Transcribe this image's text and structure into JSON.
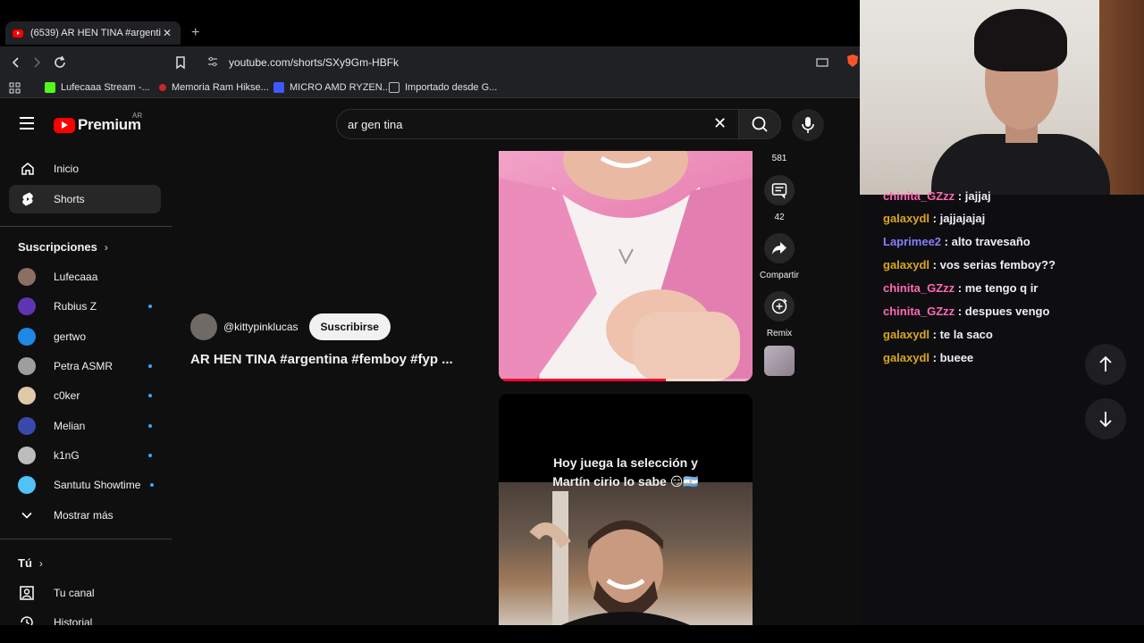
{
  "browser": {
    "tab_title": "(6539) AR HEN TINA #argentina",
    "url": "youtube.com/shorts/SXy9Gm-HBFk",
    "bookmarks": [
      {
        "label": "Lufecaaa Stream -...",
        "color": "#53fc18"
      },
      {
        "label": "Memoria Ram Hikse...",
        "color": "#c62828"
      },
      {
        "label": "MICRO AMD RYZEN...",
        "color": "#3d5afe"
      },
      {
        "label": "Importado desde G...",
        "color": "#bdbdbd"
      }
    ]
  },
  "youtube": {
    "logo_text": "Premium",
    "region": "AR",
    "search_query": "ar gen tina",
    "nav": [
      {
        "label": "Inicio"
      },
      {
        "label": "Shorts"
      }
    ],
    "subscriptions_title": "Suscripciones",
    "subscriptions": [
      {
        "name": "Lufecaaa",
        "color": "#8d6e63",
        "new": false
      },
      {
        "name": "Rubius Z",
        "color": "#5e35b1",
        "new": true
      },
      {
        "name": "gertwo",
        "color": "#1e88e5",
        "new": false
      },
      {
        "name": "Petra ASMR",
        "color": "#9e9e9e",
        "new": true
      },
      {
        "name": "c0ker",
        "color": "#e0c9a6",
        "new": true
      },
      {
        "name": "Melian",
        "color": "#3949ab",
        "new": true
      },
      {
        "name": "k1nG",
        "color": "#bdbdbd",
        "new": true
      },
      {
        "name": "Santutu Showtime",
        "color": "#4fc3f7",
        "new": true
      }
    ],
    "show_more": "Mostrar más",
    "you_title": "Tú",
    "you_items": [
      {
        "label": "Tu canal"
      },
      {
        "label": "Historial"
      }
    ],
    "short": {
      "channel_handle": "@kittypinklucas",
      "subscribe_label": "Suscribirse",
      "title": "AR HEN TINA #argentina #femboy #fyp ...",
      "progress": 0.66
    },
    "actions": {
      "like_count": "581",
      "comment_count": "42",
      "share_label": "Compartir",
      "remix_label": "Remix"
    },
    "next_short": {
      "caption_line1": "Hoy juega la selección y",
      "caption_line2": "Martín cirio lo sabe 😏🇦🇷"
    }
  },
  "chat": {
    "messages": [
      {
        "user": "chinita_GZzz",
        "text": "jajjaj",
        "color": "#ff69b4"
      },
      {
        "user": "galaxydl",
        "text": "jajjajajaj",
        "color": "#daa520"
      },
      {
        "user": "Laprimee2",
        "text": "alto travesaño",
        "color": "#8a7dff"
      },
      {
        "user": "galaxydl",
        "text": "vos serias femboy??",
        "color": "#daa520"
      },
      {
        "user": "chinita_GZzz",
        "text": "me tengo q ir",
        "color": "#ff69b4"
      },
      {
        "user": "chinita_GZzz",
        "text": "despues vengo",
        "color": "#ff69b4"
      },
      {
        "user": "galaxydl",
        "text": "te la saco",
        "color": "#daa520"
      },
      {
        "user": "galaxydl",
        "text": "bueee",
        "color": "#daa520"
      }
    ]
  }
}
